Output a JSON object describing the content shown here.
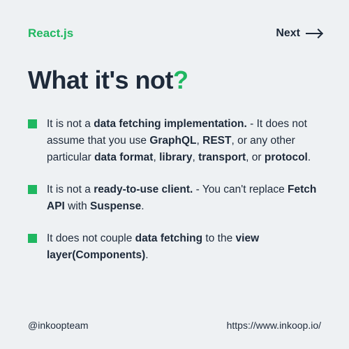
{
  "header": {
    "brand": "React.js",
    "next_label": "Next"
  },
  "title": {
    "text": "What it's not",
    "mark": "?"
  },
  "items": [
    {
      "html": "It is not a <b>data fetching implementation.</b> - It does not assume that you use <b>GraphQL</b>, <b>REST</b>, or any other particular <b>data format</b>, <b>library</b>, <b>transport</b>, or <b>protocol</b>."
    },
    {
      "html": "It is not a <b>ready-to-use client.</b> - You can't replace <b>Fetch API</b> with <b>Suspense</b>."
    },
    {
      "html": "It does not couple <b>data fetching</b> to the <b>view layer(Components)</b>."
    }
  ],
  "footer": {
    "handle": "@inkoopteam",
    "url": "https://www.inkoop.io/"
  }
}
